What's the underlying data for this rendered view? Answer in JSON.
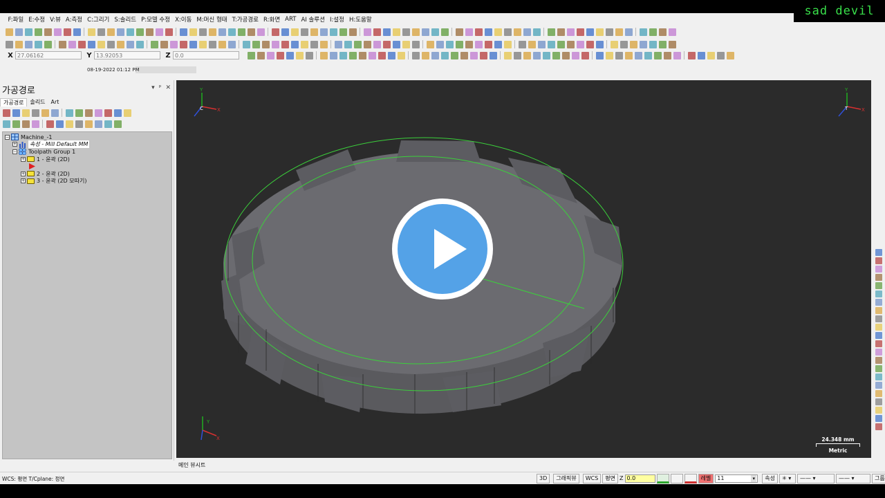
{
  "brand_text": "sad devil",
  "menu": [
    "F:파일",
    "E:수정",
    "V:뷰",
    "A:측정",
    "C:그리기",
    "S:솔리드",
    "P:모델 수정",
    "X:이동",
    "M:머신 형태",
    "T:가공경로",
    "R:화면",
    "ART",
    "AI 솔루션",
    "I:설정",
    "H:도움말"
  ],
  "coords": {
    "x_label": "X",
    "x_value": "27.06162",
    "y_label": "Y",
    "y_value": "13.92053",
    "z_label": "Z",
    "z_value": "0.0"
  },
  "datestamp": "08-19-2022 01:12 PM",
  "panel": {
    "title": "가공경로",
    "controls": [
      "▾",
      "ᵖ",
      "✕"
    ],
    "tabs": [
      "가공경로",
      "솔리드",
      "Art"
    ]
  },
  "tree": {
    "machine": "Machine_-1",
    "properties": "속성 - Mill Default MM",
    "group": "Toolpath Group 1",
    "ops": [
      "1 - 윤곽 (2D)",
      "2 - 윤곽 (2D)",
      "3 - 윤곽 (2D 모따기)"
    ]
  },
  "viewport": {
    "gview_top_left": {
      "y": "Y",
      "x": "X",
      "plane": "C"
    },
    "gview_top_right": {
      "y": "Y",
      "x": "X",
      "plane": "T"
    },
    "gview_bottom_left": {
      "y": "Y",
      "x": "X"
    },
    "scale_value": "24.348 mm",
    "scale_unit": "Metric",
    "background": "#2b2b2b",
    "edge_color": "#3bd13b",
    "solid_color": "#67676b"
  },
  "bottom_tab": "메인 뷰시트",
  "status": {
    "left": "WCS: 평면  T/Cplane: 정면",
    "btn_3d": "3D",
    "btn_gview": "그래픽뷰",
    "btn_wcs": "WCS",
    "btn_plane": "평면",
    "z_label": "Z",
    "z_value": "0.0",
    "level_label": "레벨",
    "level_value": "11",
    "attr_label": "속성",
    "group_label": "그룹"
  }
}
